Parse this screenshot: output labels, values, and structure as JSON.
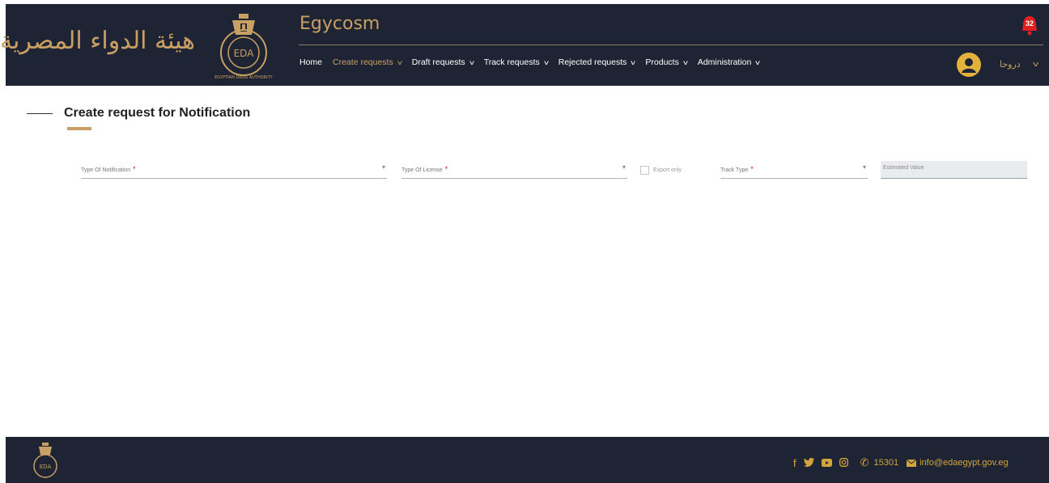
{
  "header": {
    "logo_arabic": "هيئة الدواء المصرية",
    "logo_emblem_text": "EDA",
    "logo_emblem_ring_text": "EGYPTIAN DRUG AUTHORITY",
    "app_title": "Egycosm",
    "nav": [
      {
        "label": "Home",
        "has_chevron": false,
        "active": false
      },
      {
        "label": "Create requests",
        "has_chevron": true,
        "active": true
      },
      {
        "label": "Draft requests",
        "has_chevron": true,
        "active": false
      },
      {
        "label": "Track requests",
        "has_chevron": true,
        "active": false
      },
      {
        "label": "Rejected requests",
        "has_chevron": true,
        "active": false
      },
      {
        "label": "Products",
        "has_chevron": true,
        "active": false
      },
      {
        "label": "Administration",
        "has_chevron": true,
        "active": false
      }
    ],
    "notification_count": "32",
    "user_name": "دروحا",
    "icons": {
      "bell": "bell-icon",
      "avatar": "user-avatar-icon",
      "chevron": "chevron-down-icon"
    }
  },
  "page": {
    "title": "Create request for Notification"
  },
  "form": {
    "type_of_notification": {
      "label": "Type Of Notification",
      "required": "*"
    },
    "type_of_license": {
      "label": "Type Of License",
      "required": "*"
    },
    "export_only": {
      "label": "Export only",
      "checked": false
    },
    "track_type": {
      "label": "Track Type",
      "required": "*"
    },
    "estimated_value": {
      "placeholder": "Estimated Value"
    }
  },
  "footer": {
    "phone": "15301",
    "email": "info@edaegypt.gov.eg",
    "social": [
      "facebook-icon",
      "twitter-icon",
      "youtube-icon",
      "instagram-icon"
    ]
  },
  "colors": {
    "header_bg": "#1e2433",
    "accent_gold": "#c9a063",
    "notification_red": "#e02020",
    "required_red": "#d11111"
  }
}
